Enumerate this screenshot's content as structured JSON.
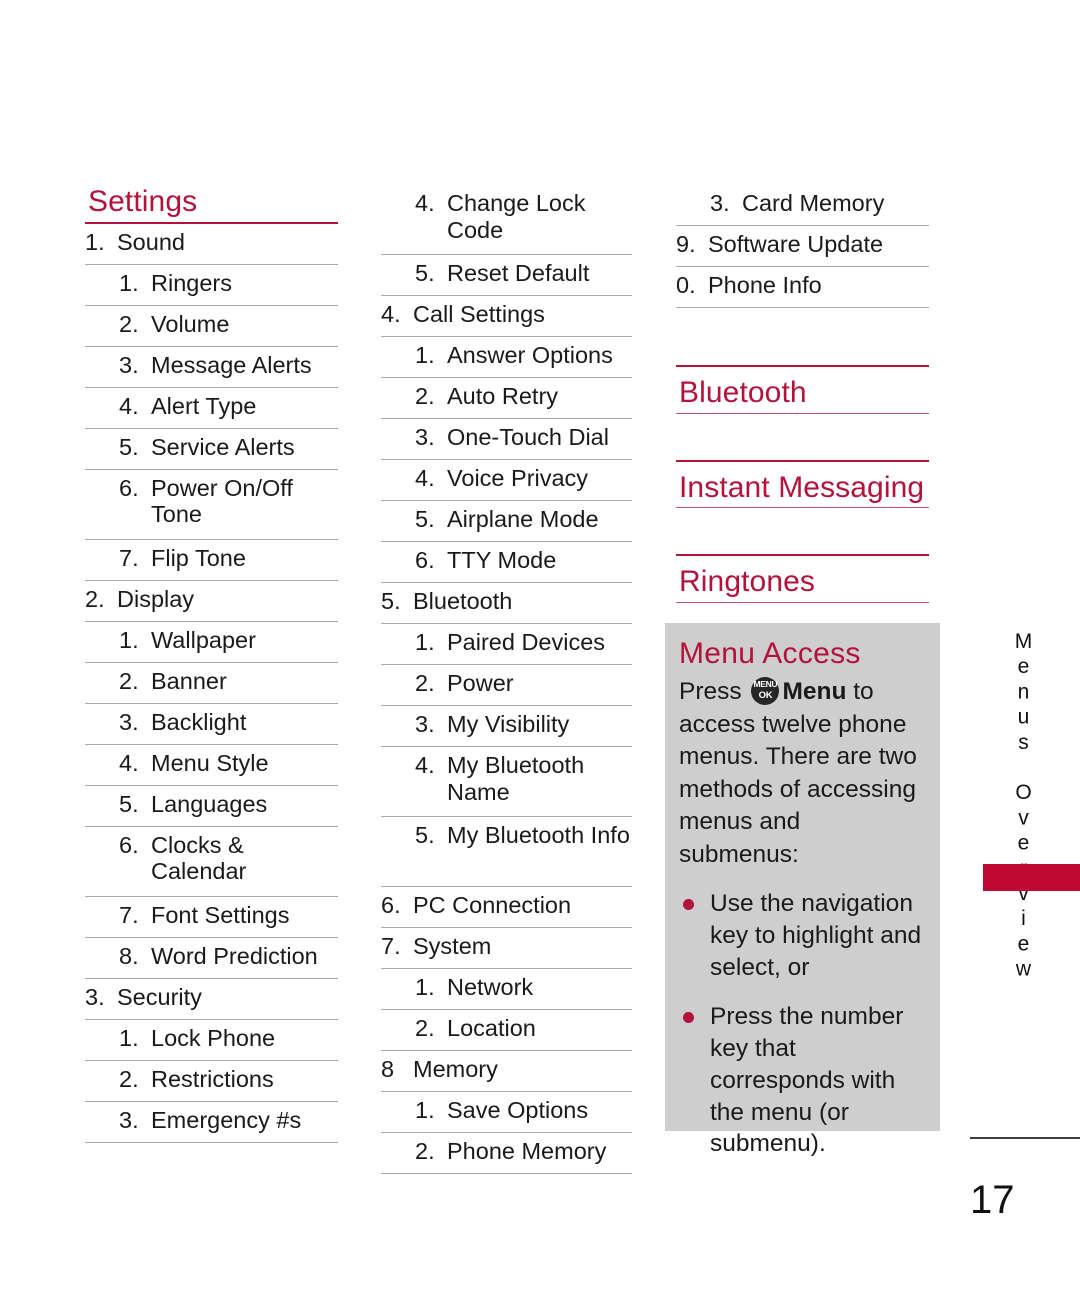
{
  "page": {
    "number": "17",
    "side_tab_label": "Menus Overview",
    "accent_color": "#B3123A",
    "tab_color": "#BE0A32",
    "box_color": "#CECECE"
  },
  "columns": [
    {
      "id": "column-1",
      "heading": "Settings",
      "rows": [
        {
          "num": "1.",
          "label": "Sound",
          "level": 1
        },
        {
          "num": "1.",
          "label": "Ringers",
          "level": 2
        },
        {
          "num": "2.",
          "label": "Volume",
          "level": 2
        },
        {
          "num": "3.",
          "label": "Message Alerts",
          "level": 2
        },
        {
          "num": "4.",
          "label": "Alert Type",
          "level": 2
        },
        {
          "num": "5.",
          "label": "Service Alerts",
          "level": 2
        },
        {
          "num": "6.",
          "label": "Power On/Off Tone",
          "level": 2,
          "tall": true
        },
        {
          "num": "7.",
          "label": "Flip Tone",
          "level": 2
        },
        {
          "num": "2.",
          "label": "Display",
          "level": 1
        },
        {
          "num": "1.",
          "label": "Wallpaper",
          "level": 2
        },
        {
          "num": "2.",
          "label": "Banner",
          "level": 2
        },
        {
          "num": "3.",
          "label": "Backlight",
          "level": 2
        },
        {
          "num": "4.",
          "label": "Menu Style",
          "level": 2
        },
        {
          "num": "5.",
          "label": "Languages",
          "level": 2
        },
        {
          "num": "6.",
          "label": "Clocks & Calendar",
          "level": 2,
          "tall": true
        },
        {
          "num": "7.",
          "label": "Font Settings",
          "level": 2
        },
        {
          "num": "8.",
          "label": "Word Prediction",
          "level": 2
        },
        {
          "num": "3.",
          "label": "Security",
          "level": 1
        },
        {
          "num": "1.",
          "label": "Lock Phone",
          "level": 2
        },
        {
          "num": "2.",
          "label": "Restrictions",
          "level": 2
        },
        {
          "num": "3.",
          "label": "Emergency #s",
          "level": 2
        }
      ]
    },
    {
      "id": "column-2",
      "heading": null,
      "rows": [
        {
          "num": "4.",
          "label": "Change Lock Code",
          "level": 2,
          "tall": true
        },
        {
          "num": "5.",
          "label": "Reset Default",
          "level": 2
        },
        {
          "num": "4.",
          "label": "Call Settings",
          "level": 1
        },
        {
          "num": "1.",
          "label": "Answer Options",
          "level": 2
        },
        {
          "num": "2.",
          "label": "Auto Retry",
          "level": 2
        },
        {
          "num": "3.",
          "label": "One-Touch Dial",
          "level": 2
        },
        {
          "num": "4.",
          "label": "Voice Privacy",
          "level": 2
        },
        {
          "num": "5.",
          "label": "Airplane Mode",
          "level": 2
        },
        {
          "num": "6.",
          "label": "TTY Mode",
          "level": 2
        },
        {
          "num": "5.",
          "label": "Bluetooth",
          "level": 1
        },
        {
          "num": "1.",
          "label": "Paired Devices",
          "level": 2
        },
        {
          "num": "2.",
          "label": "Power",
          "level": 2
        },
        {
          "num": "3.",
          "label": "My Visibility",
          "level": 2
        },
        {
          "num": "4.",
          "label": "My Bluetooth Name",
          "level": 2,
          "tall": true
        },
        {
          "num": "5.",
          "label": "My Bluetooth Info",
          "level": 2,
          "tall": true
        },
        {
          "num": "6.",
          "label": "PC Connection",
          "level": 1
        },
        {
          "num": "7.",
          "label": "System",
          "level": 1
        },
        {
          "num": "1.",
          "label": "Network",
          "level": 2
        },
        {
          "num": "2.",
          "label": "Location",
          "level": 2
        },
        {
          "num": "8",
          "label": "Memory",
          "level": 1
        },
        {
          "num": "1.",
          "label": "Save Options",
          "level": 2
        },
        {
          "num": "2.",
          "label": "Phone Memory",
          "level": 2
        }
      ]
    },
    {
      "id": "column-3",
      "heading": null,
      "rows": [
        {
          "num": "3.",
          "label": "Card Memory",
          "level": 2
        },
        {
          "num": "9.",
          "label": "Software Update",
          "level": 1
        },
        {
          "num": "0.",
          "label": "Phone Info",
          "level": 1
        }
      ],
      "section_headings": [
        {
          "label": "Bluetooth"
        },
        {
          "label": "Instant Messaging"
        },
        {
          "label": "Ringtones"
        }
      ]
    }
  ],
  "menu_access": {
    "title": "Menu Access",
    "paragraph_before_key": "Press ",
    "key_icon_top": "MENU",
    "key_icon_bottom": "OK",
    "paragraph_key_label": "Menu",
    "paragraph_after_key": " to access twelve phone menus. There are two methods of accessing menus and submenus:",
    "bullets": [
      "Use the navigation key to highlight and select, or",
      "Press the number key that corresponds with the menu (or submenu)."
    ]
  }
}
